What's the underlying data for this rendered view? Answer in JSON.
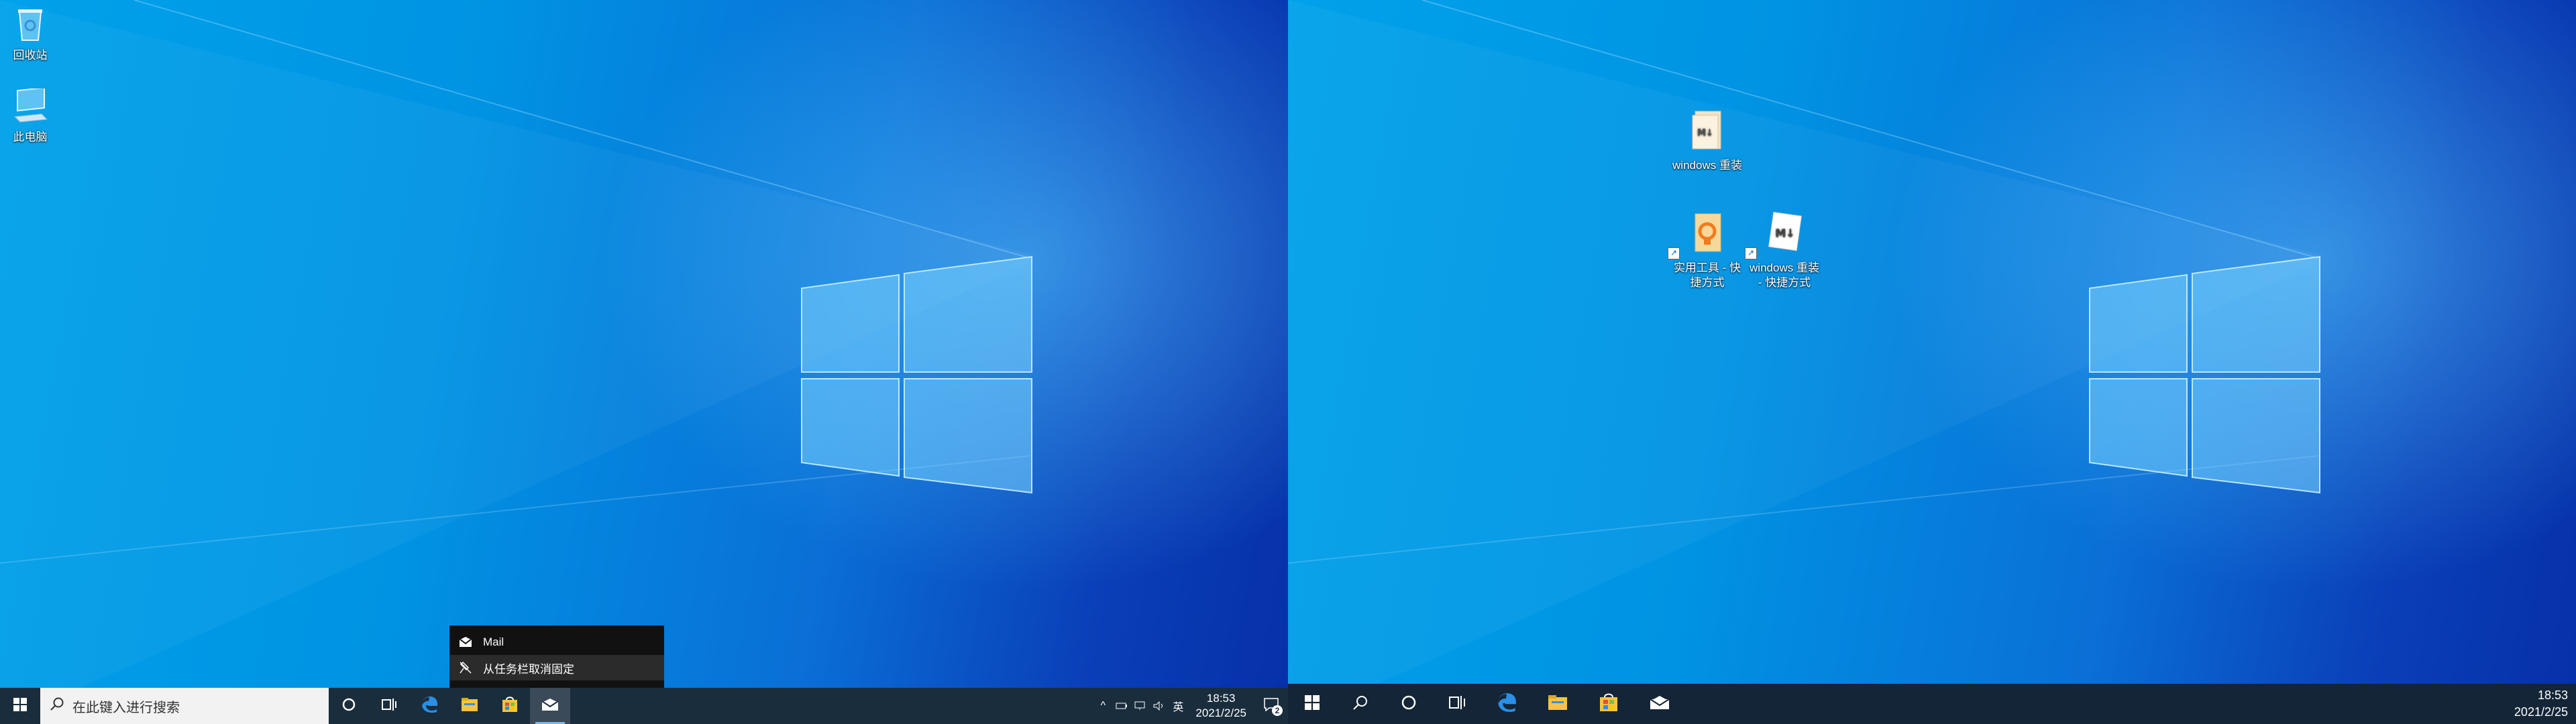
{
  "left_monitor": {
    "desktop_icons": [
      {
        "label": "回收站",
        "icon": "recycle-bin-icon"
      },
      {
        "label": "此电脑",
        "icon": "this-pc-icon"
      }
    ],
    "taskbar": {
      "search_placeholder": "在此键入进行搜索",
      "pinned": [
        "cortana-icon",
        "task-view-icon",
        "edge-icon",
        "file-explorer-icon",
        "store-icon",
        "mail-icon"
      ],
      "tray": {
        "ime": "英",
        "time": "18:53",
        "date": "2021/2/25",
        "notification_count": "2"
      }
    },
    "jump_list": {
      "app_label": "Mail",
      "unpin_label": "从任务栏取消固定"
    }
  },
  "right_monitor": {
    "desktop_icons": [
      {
        "label": "windows 重装",
        "icon": "markdown-file-icon"
      },
      {
        "label": "实用工具 - 快捷方式",
        "icon": "folder-shortcut-icon"
      },
      {
        "label": "windows 重装 - 快捷方式",
        "icon": "markdown-shortcut-icon"
      }
    ],
    "taskbar": {
      "pinned": [
        "search-icon",
        "cortana-icon",
        "task-view-icon",
        "edge-icon",
        "file-explorer-icon",
        "store-icon",
        "mail-icon"
      ],
      "time": "18:53",
      "date": "2021/2/25"
    }
  },
  "colors": {
    "accent": "#76b9ed",
    "taskbar": "#1a2d3d",
    "wallpaper_blue": "#0093e3"
  }
}
